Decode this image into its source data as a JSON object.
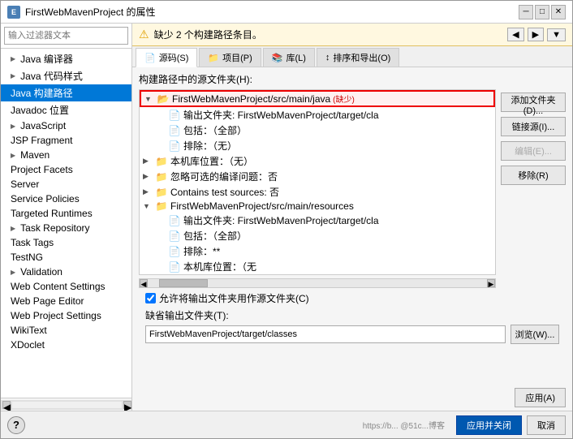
{
  "window": {
    "title": "FirstWebMavenProject 的属性",
    "icon_label": "E"
  },
  "sidebar": {
    "filter_placeholder": "输入过滤器文本",
    "items": [
      {
        "id": "java-compiler",
        "label": "Java 编译器",
        "indent": 0,
        "arrow": true,
        "selected": false
      },
      {
        "id": "java-code-style",
        "label": "Java 代码样式",
        "indent": 0,
        "arrow": true,
        "selected": false
      },
      {
        "id": "java-build-path",
        "label": "Java 构建路径",
        "indent": 0,
        "selected": true
      },
      {
        "id": "javadoc",
        "label": "Javadoc 位置",
        "indent": 0,
        "arrow": false,
        "selected": false
      },
      {
        "id": "javascript",
        "label": "JavaScript",
        "indent": 0,
        "arrow": true,
        "selected": false
      },
      {
        "id": "jsp-fragment",
        "label": "JSP Fragment",
        "indent": 0,
        "arrow": false,
        "selected": false
      },
      {
        "id": "maven",
        "label": "Maven",
        "indent": 0,
        "arrow": true,
        "selected": false
      },
      {
        "id": "project-facets",
        "label": "Project Facets",
        "indent": 0,
        "arrow": false,
        "selected": false
      },
      {
        "id": "server",
        "label": "Server",
        "indent": 0,
        "arrow": false,
        "selected": false
      },
      {
        "id": "service-policies",
        "label": "Service Policies",
        "indent": 0,
        "arrow": false,
        "selected": false
      },
      {
        "id": "targeted-runtimes",
        "label": "Targeted Runtimes",
        "indent": 0,
        "arrow": false,
        "selected": false
      },
      {
        "id": "task-repository",
        "label": "Task Repository",
        "indent": 0,
        "arrow": true,
        "selected": false
      },
      {
        "id": "task-tags",
        "label": "Task Tags",
        "indent": 0,
        "arrow": false,
        "selected": false
      },
      {
        "id": "testng",
        "label": "TestNG",
        "indent": 0,
        "arrow": false,
        "selected": false
      },
      {
        "id": "validation",
        "label": "Validation",
        "indent": 0,
        "arrow": true,
        "selected": false
      },
      {
        "id": "web-content-settings",
        "label": "Web Content Settings",
        "indent": 0,
        "arrow": false,
        "selected": false
      },
      {
        "id": "web-page-editor",
        "label": "Web Page Editor",
        "indent": 0,
        "arrow": false,
        "selected": false
      },
      {
        "id": "web-project-settings",
        "label": "Web Project Settings",
        "indent": 0,
        "arrow": false,
        "selected": false
      },
      {
        "id": "wikitext",
        "label": "WikiText",
        "indent": 0,
        "arrow": false,
        "selected": false
      },
      {
        "id": "xdoclet",
        "label": "XDoclet",
        "indent": 0,
        "arrow": false,
        "selected": false
      }
    ]
  },
  "warning": {
    "text": "缺少 2 个构建路径条目。",
    "nav_back": "◀",
    "nav_forward": "▶",
    "nav_more": "▼"
  },
  "tabs": [
    {
      "id": "source",
      "label": "源码(S)",
      "icon": "📄",
      "active": true
    },
    {
      "id": "projects",
      "label": "项目(P)",
      "icon": "📁",
      "active": false
    },
    {
      "id": "libraries",
      "label": "库(L)",
      "icon": "📚",
      "active": false
    },
    {
      "id": "order",
      "label": "排序和导出(O)",
      "icon": "↕",
      "active": false
    }
  ],
  "panel": {
    "section_label": "构建路径中的源文件夹(H):",
    "tree_items": [
      {
        "id": "src-main-java",
        "level": 0,
        "expanded": true,
        "error": true,
        "label": "FirstWebMavenProject/src/main/java",
        "badge": "缺少"
      },
      {
        "id": "output-folder-1",
        "level": 1,
        "expanded": false,
        "error": false,
        "label": "输出文件夹: FirstWebMavenProject/target/cla",
        "badge": ""
      },
      {
        "id": "includes-1",
        "level": 1,
        "expanded": false,
        "error": false,
        "label": "包括：（全部）",
        "badge": ""
      },
      {
        "id": "excludes-1",
        "level": 1,
        "expanded": false,
        "error": false,
        "label": "排除：（无）",
        "badge": ""
      },
      {
        "id": "local-lib",
        "level": 0,
        "expanded": false,
        "error": false,
        "label": "本机库位置：（无）",
        "badge": ""
      },
      {
        "id": "ignored-problems",
        "level": 0,
        "expanded": false,
        "error": false,
        "label": "忽略可选的编译问题：否",
        "badge": ""
      },
      {
        "id": "test-sources",
        "level": 0,
        "expanded": false,
        "error": false,
        "label": "Contains test sources: 否",
        "badge": ""
      },
      {
        "id": "src-main-resources",
        "level": 0,
        "expanded": true,
        "error": false,
        "label": "FirstWebMavenProject/src/main/resources",
        "badge": ""
      },
      {
        "id": "output-folder-2",
        "level": 1,
        "expanded": false,
        "error": false,
        "label": "输出文件夹: FirstWebMavenProject/target/cla",
        "badge": ""
      },
      {
        "id": "includes-2",
        "level": 1,
        "expanded": false,
        "error": false,
        "label": "包括：（全部）",
        "badge": ""
      },
      {
        "id": "excludes-2",
        "level": 1,
        "expanded": false,
        "error": false,
        "label": "排除：**",
        "badge": ""
      },
      {
        "id": "local-lib-2",
        "level": 1,
        "expanded": false,
        "error": false,
        "label": "本机库位置：（无",
        "badge": ""
      }
    ],
    "buttons": [
      {
        "id": "add-folder",
        "label": "添加文件夹(D)...",
        "enabled": true
      },
      {
        "id": "link-source",
        "label": "链接源(I)...",
        "enabled": true
      },
      {
        "id": "edit",
        "label": "编辑(E)...",
        "enabled": false
      },
      {
        "id": "remove",
        "label": "移除(R)",
        "enabled": true
      }
    ],
    "checkbox_label": "允许将输出文件夹用作源文件夹(C)",
    "checkbox_checked": true,
    "output_folder_label": "缺省输出文件夹(T):",
    "output_folder_value": "FirstWebMavenProject/target/classes",
    "browse_btn": "浏览(W)..."
  },
  "footer": {
    "help": "?",
    "apply_close_btn": "应用并关闭",
    "cancel_btn": "取消",
    "apply_btn": "应用(A)",
    "info_text": "https://b... @51c...博客"
  }
}
